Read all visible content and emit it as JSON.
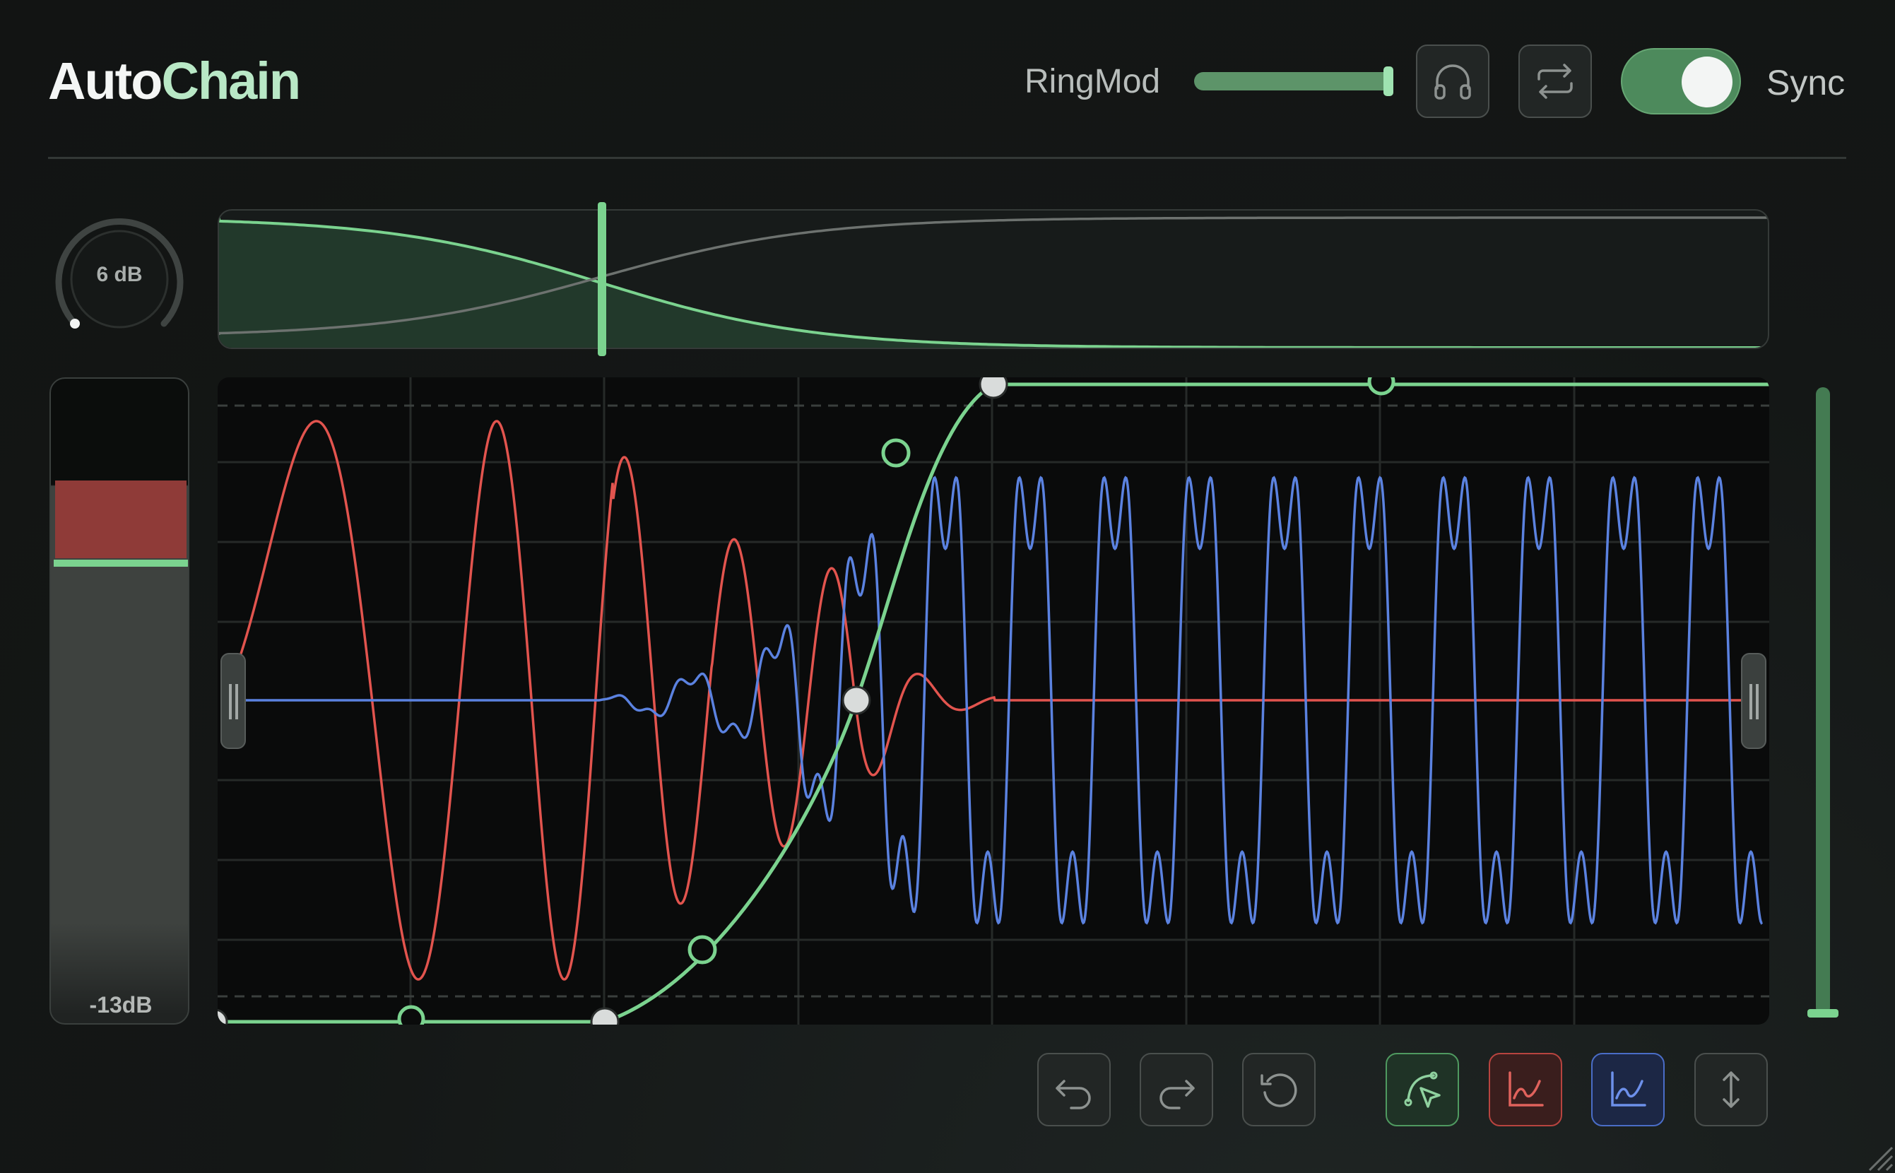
{
  "app": {
    "title_part1": "Auto",
    "title_part2": "Chain"
  },
  "header": {
    "ringmod_label": "RingMod",
    "ringmod_level": 1.0,
    "sync_label": "Sync",
    "sync_on": true,
    "buttons": [
      {
        "name": "headphones-button",
        "icon": "headphones-icon"
      },
      {
        "name": "swap-button",
        "icon": "swap-arrows-icon"
      }
    ]
  },
  "knob": {
    "value": "6 dB"
  },
  "meter": {
    "value": "-13dB"
  },
  "colors": {
    "accent": "#7bd38f",
    "signal_a": "#e2544e",
    "signal_b": "#5b82e0",
    "background": "#141716"
  },
  "toolbar": {
    "history": [
      {
        "name": "undo-button",
        "icon": "undo-icon"
      },
      {
        "name": "redo-button",
        "icon": "redo-icon"
      },
      {
        "name": "reset-button",
        "icon": "reset-icon"
      }
    ],
    "modes": [
      {
        "name": "curve-edit-button",
        "icon": "curve-pointer-icon"
      },
      {
        "name": "red-curve-button",
        "icon": "red-curve-icon"
      },
      {
        "name": "blue-curve-button",
        "icon": "blue-curve-icon"
      },
      {
        "name": "vertical-resize-button",
        "icon": "vertical-arrows-icon"
      }
    ]
  }
}
